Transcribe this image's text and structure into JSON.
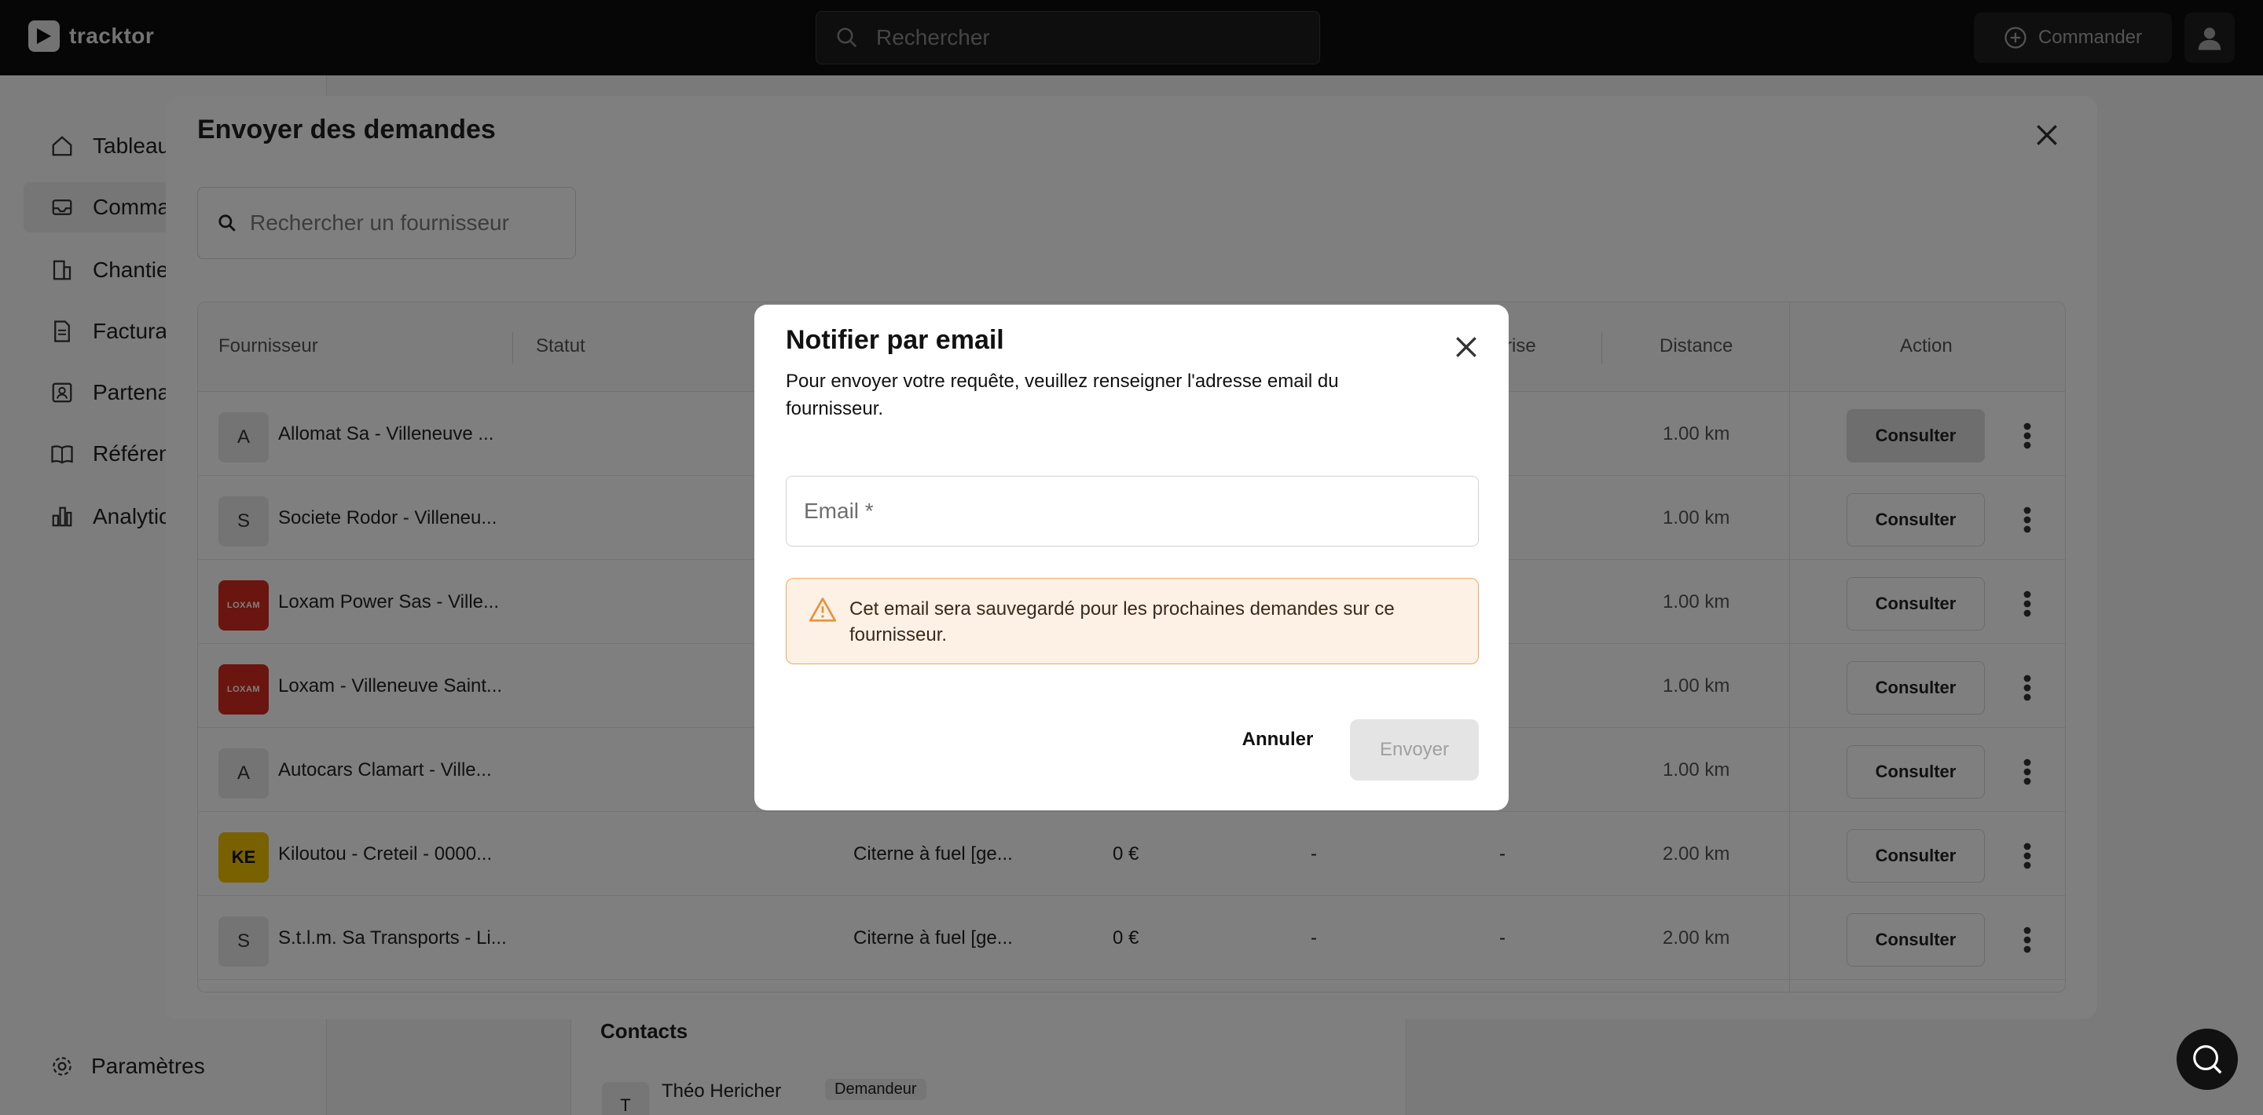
{
  "app": {
    "logo_text": "tracktor"
  },
  "topbar": {
    "search_placeholder": "Rechercher",
    "commander_label": "Commander"
  },
  "sidebar": {
    "items": [
      {
        "label": "Tableau",
        "icon": "home-icon"
      },
      {
        "label": "Comma",
        "icon": "inbox-icon"
      },
      {
        "label": "Chantie",
        "icon": "building-icon"
      },
      {
        "label": "Factura",
        "icon": "invoice-icon"
      },
      {
        "label": "Partena",
        "icon": "contact-card-icon"
      },
      {
        "label": "Référen",
        "icon": "book-icon"
      },
      {
        "label": "Analytic",
        "icon": "bar-chart-icon"
      }
    ],
    "settings_label": "Paramètres"
  },
  "background_page": {
    "contacts_title": "Contacts",
    "contact_initial": "T",
    "contact_name": "Théo Hericher",
    "contact_badge": "Demandeur"
  },
  "main_modal": {
    "title": "Envoyer des demandes",
    "search_placeholder": "Rechercher un fournisseur",
    "columns": [
      "Fournisseur",
      "Statut",
      "rise",
      "Distance",
      "Action"
    ],
    "rows": [
      {
        "initial": "A",
        "name": "Allomat Sa - Villeneuve ...",
        "material": "",
        "price": "",
        "dash1": "",
        "dash2": "",
        "distance": "1.00 km",
        "action": "Consulter",
        "logo": "initial"
      },
      {
        "initial": "S",
        "name": "Societe Rodor - Villeneu...",
        "material": "",
        "price": "",
        "dash1": "",
        "dash2": "",
        "distance": "1.00 km",
        "action": "Consulter",
        "logo": "initial"
      },
      {
        "initial": "LOXAM",
        "name": "Loxam Power Sas - Ville...",
        "material": "",
        "price": "",
        "dash1": "",
        "dash2": "",
        "distance": "1.00 km",
        "action": "Consulter",
        "logo": "loxam"
      },
      {
        "initial": "LOXAM",
        "name": "Loxam - Villeneuve Saint...",
        "material": "",
        "price": "",
        "dash1": "",
        "dash2": "",
        "distance": "1.00 km",
        "action": "Consulter",
        "logo": "loxam"
      },
      {
        "initial": "A",
        "name": "Autocars Clamart - Ville...",
        "material": "",
        "price": "",
        "dash1": "",
        "dash2": "",
        "distance": "1.00 km",
        "action": "Consulter",
        "logo": "initial"
      },
      {
        "initial": "KE",
        "name": "Kiloutou - Creteil - 0000...",
        "material": "Citerne à fuel [ge...",
        "price": "0 €",
        "dash1": "-",
        "dash2": "-",
        "distance": "2.00 km",
        "action": "Consulter",
        "logo": "kiloutou"
      },
      {
        "initial": "S",
        "name": "S.t.l.m. Sa Transports - Li...",
        "material": "Citerne à fuel [ge...",
        "price": "0 €",
        "dash1": "-",
        "dash2": "-",
        "distance": "2.00 km",
        "action": "Consulter",
        "logo": "initial"
      }
    ]
  },
  "notify_dialog": {
    "title": "Notifier par email",
    "description": "Pour envoyer votre requête, veuillez renseigner l'adresse email du fournisseur.",
    "email_placeholder": "Email *",
    "warning": "Cet email sera sauvegardé pour les prochaines demandes sur ce fournisseur.",
    "cancel_label": "Annuler",
    "send_label": "Envoyer"
  },
  "colors": {
    "topbar": "#0d0d0d",
    "warning_bg": "#fdf1e6",
    "warning_border": "#f0a95c",
    "loxam": "#d52b1e",
    "kiloutou": "#f3c300"
  }
}
